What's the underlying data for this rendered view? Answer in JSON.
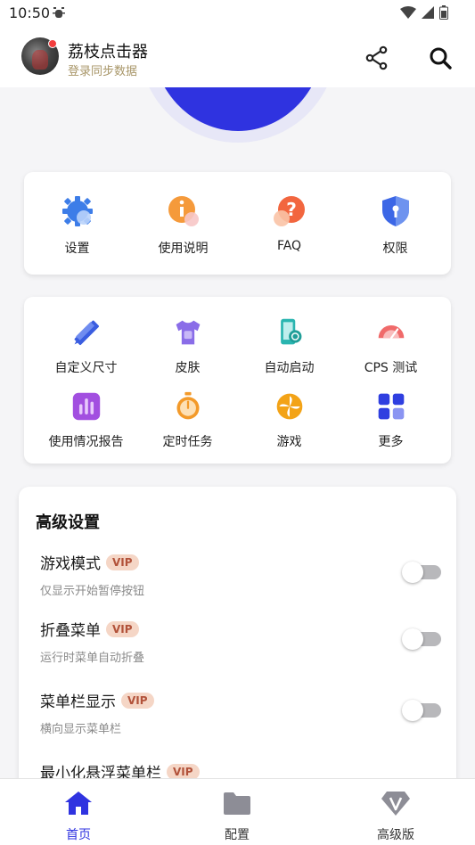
{
  "status_bar": {
    "time": "10:50"
  },
  "header": {
    "title": "荔枝点击器",
    "subtitle": "登录同步数据"
  },
  "quick_actions": [
    {
      "label": "设置",
      "icon": "gear-icon"
    },
    {
      "label": "使用说明",
      "icon": "info-icon"
    },
    {
      "label": "FAQ",
      "icon": "question-icon"
    },
    {
      "label": "权限",
      "icon": "shield-icon"
    }
  ],
  "tools": [
    {
      "label": "自定义尺寸",
      "icon": "ruler-pencil-icon"
    },
    {
      "label": "皮肤",
      "icon": "tshirt-icon"
    },
    {
      "label": "自动启动",
      "icon": "phone-autostart-icon"
    },
    {
      "label": "CPS 测试",
      "icon": "speedometer-icon"
    },
    {
      "label": "使用情况报告",
      "icon": "bar-chart-icon"
    },
    {
      "label": "定时任务",
      "icon": "stopwatch-icon"
    },
    {
      "label": "游戏",
      "icon": "pinwheel-icon"
    },
    {
      "label": "更多",
      "icon": "grid-more-icon"
    }
  ],
  "advanced": {
    "title": "高级设置",
    "vip_label": "VIP",
    "items": [
      {
        "name": "游戏模式",
        "desc": "仅显示开始暂停按钮",
        "enabled": false
      },
      {
        "name": "折叠菜单",
        "desc": "运行时菜单自动折叠",
        "enabled": false
      },
      {
        "name": "菜单栏显示",
        "desc": "横向显示菜单栏",
        "enabled": false
      },
      {
        "name": "最小化悬浮菜单栏",
        "desc": "",
        "enabled": false
      }
    ]
  },
  "bottom_nav": [
    {
      "label": "首页",
      "active": true,
      "icon": "home-icon"
    },
    {
      "label": "配置",
      "active": false,
      "icon": "folder-icon"
    },
    {
      "label": "高级版",
      "active": false,
      "icon": "diamond-v-icon"
    }
  ],
  "colors": {
    "accent": "#2f33e0",
    "vip_bg": "#f5d6c6",
    "vip_text": "#b2523a",
    "subtitle": "#a89668"
  }
}
